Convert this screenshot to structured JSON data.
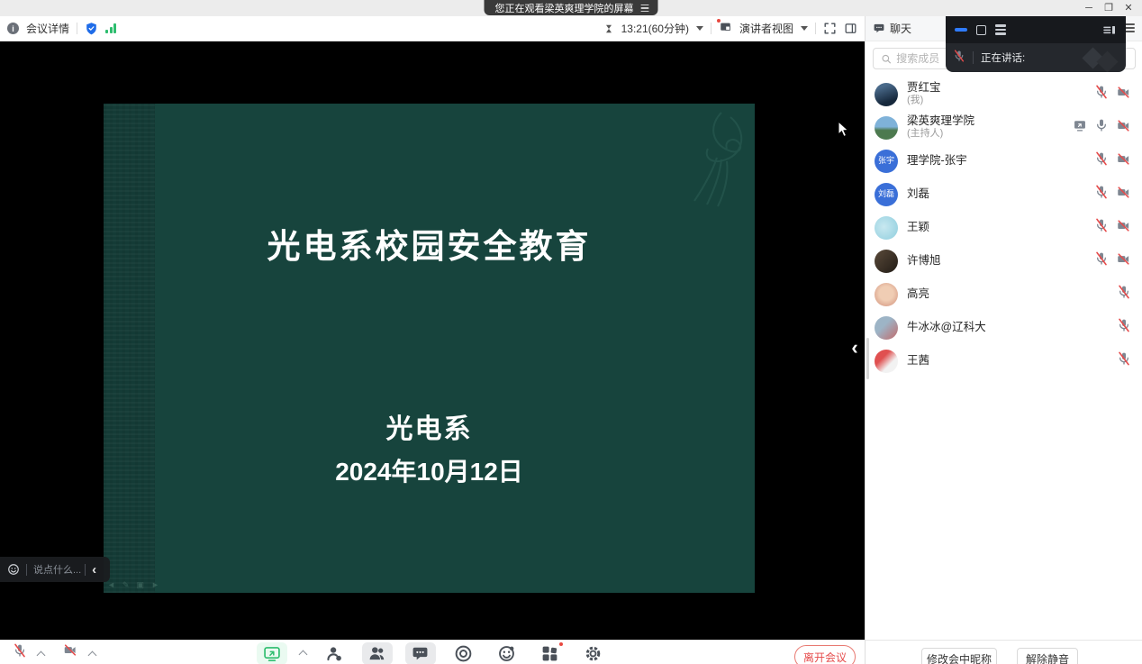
{
  "colors": {
    "accent_blue": "#2f7bff",
    "danger_red": "#e64b4b",
    "signal_green": "#2dbd6e",
    "slide_teal": "#17443d",
    "avatar_blue": "#3a6fd8"
  },
  "titlebar": {
    "banner": "您正在观看梁英爽理学院的屏幕"
  },
  "toolbar": {
    "meeting_details": "会议详情",
    "timer": "13:21(60分钟)",
    "view_mode": "演讲者视图"
  },
  "slide": {
    "title": "光电系校园安全教育",
    "subtitle": "光电系",
    "date": "2024年10月12日"
  },
  "stage": {
    "message_placeholder": "说点什么..."
  },
  "bottom_bar": {
    "leave_label": "离开会议",
    "icons": [
      "share-screen",
      "invite",
      "participants",
      "chat",
      "record",
      "reactions",
      "apps",
      "settings"
    ]
  },
  "floating_window": {
    "speaking_label": "正在讲话:"
  },
  "panel": {
    "tab_chat": "聊天",
    "search_placeholder": "搜索成员",
    "rename_label": "修改会中昵称",
    "unmute_label": "解除静音",
    "participants": [
      {
        "name": "贾红宝",
        "sub": "(我)",
        "avatar_kind": "photo",
        "avatar_text": "",
        "avatar_style": "linear-gradient(160deg,#4a6a8a 20%,#16283c 75%)",
        "mic": "muted",
        "camera": "off",
        "sharing": false
      },
      {
        "name": "梁英爽理学院",
        "sub": "(主持人)",
        "avatar_kind": "photo",
        "avatar_text": "",
        "avatar_style": "linear-gradient(180deg,#7fb2d9 45%,#4d7a4f 60%)",
        "mic": "on",
        "camera": "off",
        "sharing": true
      },
      {
        "name": "理学院-张宇",
        "sub": "",
        "avatar_kind": "text",
        "avatar_text": "张宇",
        "avatar_style": "#3a6fd8",
        "mic": "muted",
        "camera": "off",
        "sharing": false
      },
      {
        "name": "刘磊",
        "sub": "",
        "avatar_kind": "text",
        "avatar_text": "刘磊",
        "avatar_style": "#3a6fd8",
        "mic": "muted",
        "camera": "off",
        "sharing": false
      },
      {
        "name": "王颖",
        "sub": "",
        "avatar_kind": "photo",
        "avatar_text": "",
        "avatar_style": "radial-gradient(circle at 40% 45%,#c8e8f0,#8fcede)",
        "mic": "muted",
        "camera": "off",
        "sharing": false
      },
      {
        "name": "许博旭",
        "sub": "",
        "avatar_kind": "photo",
        "avatar_text": "",
        "avatar_style": "linear-gradient(135deg,#5a4a3a,#221c16)",
        "mic": "muted",
        "camera": "off",
        "sharing": false
      },
      {
        "name": "高亮",
        "sub": "",
        "avatar_kind": "photo",
        "avatar_text": "",
        "avatar_style": "radial-gradient(circle at 50% 45%,#f0cdb4 40%,#cf8d78)",
        "mic": "muted",
        "camera": "",
        "sharing": false
      },
      {
        "name": "牛冰冰@辽科大",
        "sub": "",
        "avatar_kind": "photo",
        "avatar_text": "",
        "avatar_style": "linear-gradient(135deg,#9db4c6 40%,#c26a6a)",
        "mic": "muted",
        "camera": "",
        "sharing": false
      },
      {
        "name": "王茜",
        "sub": "",
        "avatar_kind": "photo",
        "avatar_text": "",
        "avatar_style": "linear-gradient(135deg,#e05050 35%,#f2f2f2 65%)",
        "mic": "muted",
        "camera": "",
        "sharing": false
      }
    ]
  }
}
